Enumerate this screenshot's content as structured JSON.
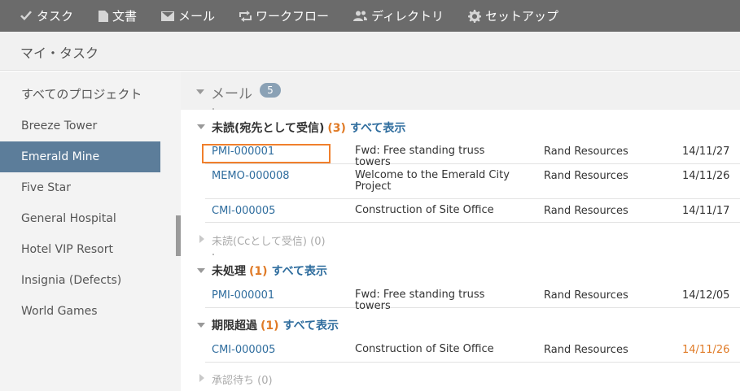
{
  "topnav": {
    "items": [
      {
        "label": "タスク",
        "icon": "check-icon"
      },
      {
        "label": "文書",
        "icon": "document-icon"
      },
      {
        "label": "メール",
        "icon": "envelope-icon"
      },
      {
        "label": "ワークフロー",
        "icon": "workflow-icon"
      },
      {
        "label": "ディレクトリ",
        "icon": "people-icon"
      },
      {
        "label": "セットアップ",
        "icon": "gear-icon"
      }
    ]
  },
  "page": {
    "title": "マイ・タスク"
  },
  "sidebar": {
    "header": "すべてのプロジェクト",
    "items": [
      "Breeze Tower",
      "Emerald Mine",
      "Five Star",
      "General Hospital",
      "Hotel VIP Resort",
      "Insignia (Defects)",
      "World Games"
    ],
    "active": "Emerald Mine"
  },
  "mail": {
    "title": "メール",
    "badge": "5",
    "sections": [
      {
        "label": "未読(宛先として受信)",
        "count": "(3)",
        "show_all": "すべて表示",
        "rows": [
          {
            "id": "PMI-000001",
            "subject": "Fwd: Free standing truss towers",
            "sender": "Rand Resources",
            "date": "14/11/27"
          },
          {
            "id": "MEMO-000008",
            "subject": "Welcome to the Emerald City Project",
            "sender": "Rand Resources",
            "date": "14/11/26"
          },
          {
            "id": "CMI-000005",
            "subject": "Construction of Site Office",
            "sender": "Rand Resources",
            "date": "14/11/17"
          }
        ]
      },
      {
        "label": "未読(Ccとして受信)",
        "count": "(0)",
        "collapsed": true
      },
      {
        "label": "未処理",
        "count": "(1)",
        "show_all": "すべて表示",
        "rows": [
          {
            "id": "PMI-000001",
            "subject": "Fwd: Free standing truss towers",
            "sender": "Rand Resources",
            "date": "14/12/05"
          }
        ]
      },
      {
        "label": "期限超過",
        "count": "(1)",
        "show_all": "すべて表示",
        "rows": [
          {
            "id": "CMI-000005",
            "subject": "Construction of Site Office",
            "sender": "Rand Resources",
            "date": "14/11/26"
          }
        ]
      },
      {
        "label": "承認待ち",
        "count": "(0)",
        "collapsed": true
      }
    ]
  },
  "colors": {
    "accent": "#5c7d9a",
    "link": "#2f6d9e",
    "count": "#e07b27",
    "topnav": "#6b6b6b",
    "highlight": "#f07f2c"
  }
}
